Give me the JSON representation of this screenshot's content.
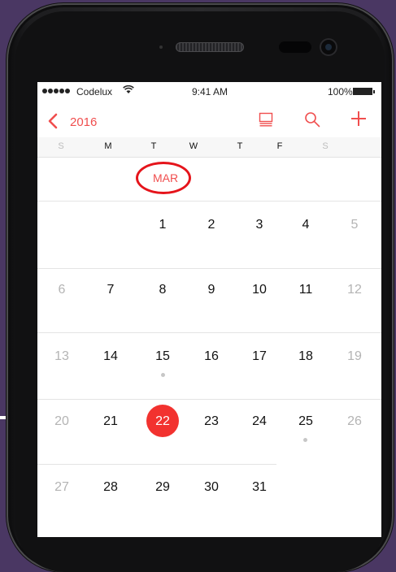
{
  "status_bar": {
    "carrier": "Codelux",
    "time": "9:41 AM",
    "battery": "100%"
  },
  "nav": {
    "year": "2016",
    "icons": [
      "chevron-left-icon",
      "list-view-icon",
      "search-icon",
      "add-icon"
    ]
  },
  "weekdays": [
    "S",
    "M",
    "T",
    "W",
    "T",
    "F",
    "S"
  ],
  "calendar": {
    "month": "MAR",
    "today": "22",
    "event_days": [
      "15",
      "25"
    ],
    "weeks": [
      [
        "",
        "",
        "1",
        "2",
        "3",
        "4",
        "5"
      ],
      [
        "6",
        "7",
        "8",
        "9",
        "10",
        "11",
        "12"
      ],
      [
        "13",
        "14",
        "15",
        "16",
        "17",
        "18",
        "19"
      ],
      [
        "20",
        "21",
        "22",
        "23",
        "24",
        "25",
        "26"
      ],
      [
        "27",
        "28",
        "29",
        "30",
        "31",
        "",
        ""
      ]
    ]
  },
  "colors": {
    "accent": "#f04e4e",
    "today_fill": "#f2322f",
    "annotation_circle": "#e5141b",
    "background": "#4a3763"
  }
}
